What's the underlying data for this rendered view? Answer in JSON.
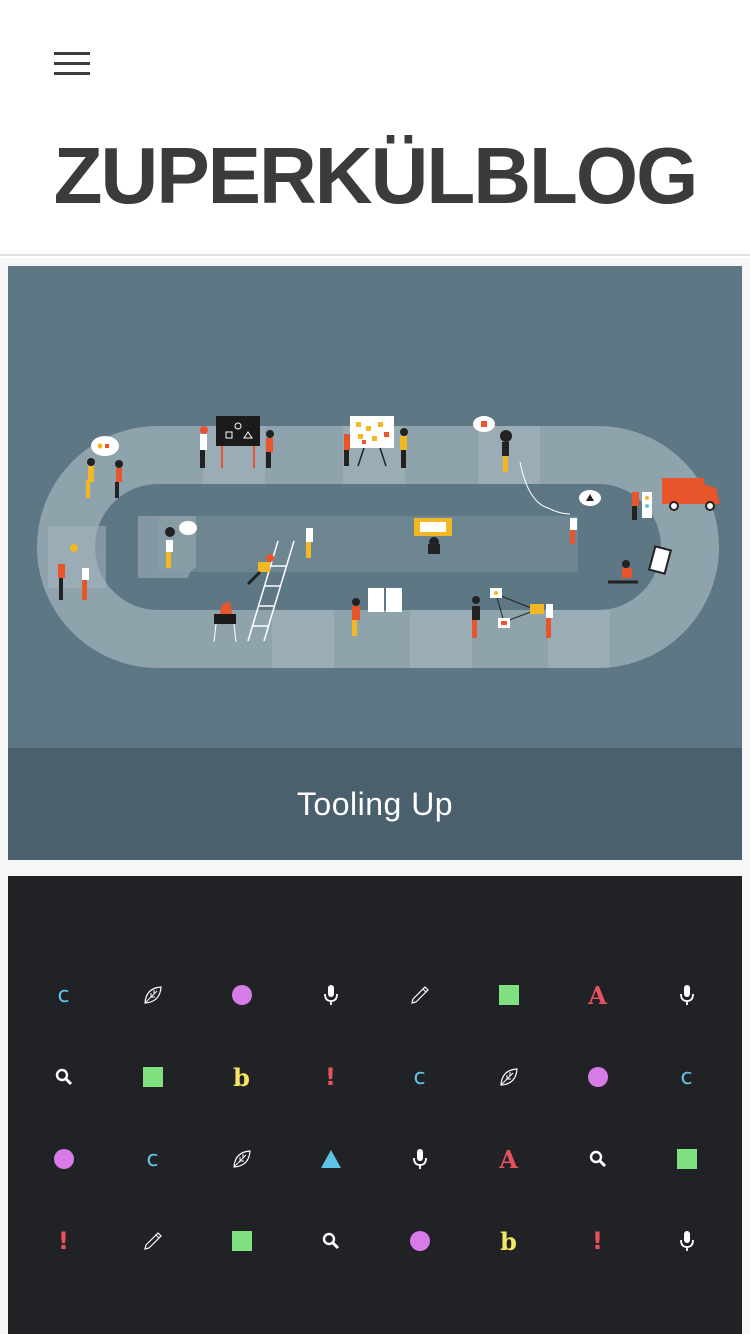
{
  "header": {
    "menu_icon": "hamburger-menu-icon",
    "site_title": "ZUPERKÜLBLOG"
  },
  "posts": [
    {
      "title": "Tooling Up",
      "image": "illustration-board-game-path-with-people-and-delivery-van",
      "colors": {
        "background": "#5d7785",
        "caption_bg": "#4a606c",
        "path": "#8fa3ad"
      }
    },
    {
      "image": "icon-pattern-grid",
      "colors": {
        "background": "#212226"
      },
      "pattern": [
        [
          "c",
          "leaf",
          "circle",
          "mic",
          "pencil",
          "square",
          "A",
          "mic"
        ],
        [
          "search",
          "square",
          "b",
          "exclaim",
          "c",
          "leaf",
          "circle",
          "c"
        ],
        [
          "circle",
          "c",
          "leaf",
          "triangle",
          "mic",
          "A",
          "search",
          "square"
        ],
        [
          "exclaim",
          "pencil",
          "square",
          "search",
          "circle",
          "b",
          "exclaim",
          "mic"
        ]
      ]
    }
  ],
  "glyphs": {
    "c": {
      "text": "c",
      "color": "#5ec4e6"
    },
    "A": {
      "text": "A",
      "color": "#e8525c"
    },
    "b": {
      "text": "b",
      "color": "#f5e663"
    },
    "exclaim": {
      "text": "!",
      "color": "#e8525c"
    }
  },
  "glyph_colors": {
    "circle": "#d77be8",
    "square": "#7ee07e",
    "triangle": "#5ec4e6",
    "mic": "#ffffff",
    "search": "#ffffff",
    "leaf": "#ffffff",
    "pencil": "#ffffff"
  }
}
